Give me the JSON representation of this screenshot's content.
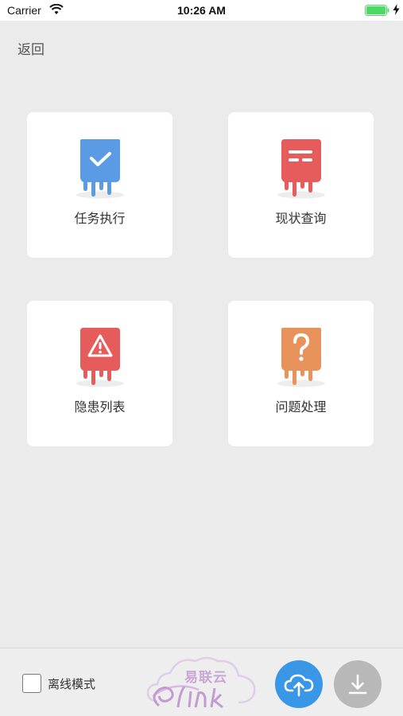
{
  "status_bar": {
    "carrier": "Carrier",
    "time": "10:26 AM",
    "icons": [
      "wifi-icon",
      "battery-icon",
      "charging-bolt-icon"
    ],
    "battery_color": "#4cd964"
  },
  "header": {
    "back_label": "返回"
  },
  "menu": {
    "items": [
      {
        "label": "任务执行",
        "icon": "check-icon",
        "color": "#5b9be6"
      },
      {
        "label": "现状查询",
        "icon": "document-icon",
        "color": "#e65c5c"
      },
      {
        "label": "隐患列表",
        "icon": "warning-icon",
        "color": "#e65c5c"
      },
      {
        "label": "问题处理",
        "icon": "question-icon",
        "color": "#e8935b"
      }
    ]
  },
  "bottom_bar": {
    "offline_label": "离线模式",
    "offline_checked": false,
    "logo_text": "易联云",
    "upload_icon": "cloud-upload-icon",
    "download_icon": "download-icon",
    "upload_color": "#3a96e6",
    "download_color": "#b8b8b8"
  }
}
